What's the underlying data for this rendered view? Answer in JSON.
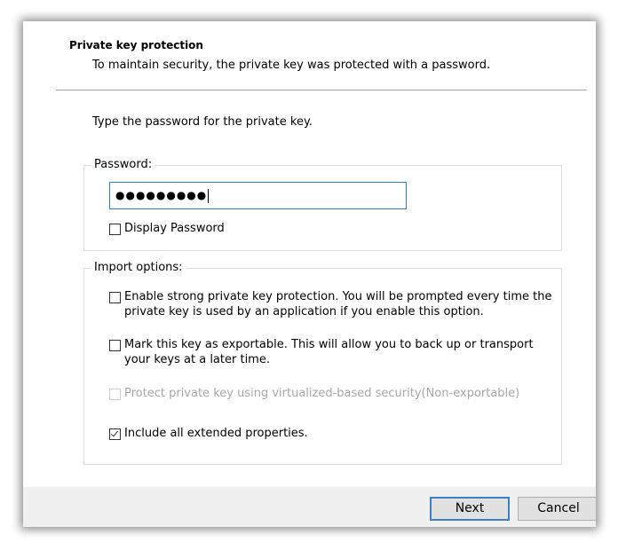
{
  "header": {
    "title": "Private key protection",
    "description": "To maintain security, the private key was protected with a password."
  },
  "instruction": "Type the password for the private key.",
  "password_group": {
    "legend": "Password:",
    "masked_value": "●●●●●●●●●",
    "display_password": {
      "label": "Display Password",
      "checked": false
    }
  },
  "import_options": {
    "legend": "Import options:",
    "options": [
      {
        "label": "Enable strong private key protection. You will be prompted every time the private key is used by an application if you enable this option.",
        "checked": false,
        "disabled": false
      },
      {
        "label": "Mark this key as exportable. This will allow you to back up or transport your keys at a later time.",
        "checked": false,
        "disabled": false
      },
      {
        "label": "Protect private key using virtualized-based security(Non-exportable)",
        "checked": false,
        "disabled": true
      },
      {
        "label": "Include all extended properties.",
        "checked": true,
        "disabled": false
      }
    ]
  },
  "footer": {
    "next_label": "Next",
    "cancel_label": "Cancel"
  },
  "colors": {
    "focus_border": "#2a7fd0",
    "footer_bg": "#f0f0f0",
    "disabled_text": "#a6a6a6"
  }
}
